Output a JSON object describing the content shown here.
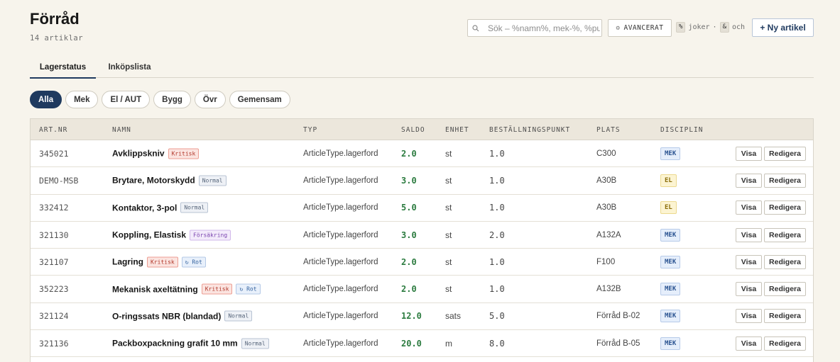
{
  "page": {
    "title": "Förråd",
    "count": "14 artiklar"
  },
  "search": {
    "placeholder": "Sök – %namn%, mek-%, %pump",
    "icon": "search-icon"
  },
  "advanced": {
    "label": "AVANCERAT",
    "icon": "gear-icon"
  },
  "hints": {
    "wildcard_key": "%",
    "wildcard_text": "joker",
    "sep": "·",
    "and_key": "&",
    "and_text": "och"
  },
  "new_button": {
    "label": "+ Ny artikel"
  },
  "tabs": [
    {
      "label": "Lagerstatus",
      "active": true
    },
    {
      "label": "Inköpslista",
      "active": false
    }
  ],
  "filters": [
    {
      "label": "Alla",
      "active": true
    },
    {
      "label": "Mek",
      "active": false
    },
    {
      "label": "El / AUT",
      "active": false
    },
    {
      "label": "Bygg",
      "active": false
    },
    {
      "label": "Övr",
      "active": false
    },
    {
      "label": "Gemensam",
      "active": false
    }
  ],
  "columns": {
    "artnr": "ART.NR",
    "namn": "NAMN",
    "typ": "TYP",
    "saldo": "SALDO",
    "enhet": "ENHET",
    "best": "BESTÄLLNINGSPUNKT",
    "plats": "PLATS",
    "disciplin": "DISCIPLIN"
  },
  "actions": {
    "view": "Visa",
    "edit": "Redigera"
  },
  "rows": [
    {
      "artnr": "345021",
      "namn": "Avklippskniv",
      "tags": [
        {
          "label": "Kritisk",
          "kind": "kritisk"
        }
      ],
      "typ": "ArticleType.lagerford",
      "saldo": "2.0",
      "enhet": "st",
      "best": "1.0",
      "plats": "C300",
      "disciplin": "MEK",
      "disc_kind": "mek"
    },
    {
      "artnr": "DEMO-MSB",
      "namn": "Brytare, Motorskydd",
      "tags": [
        {
          "label": "Normal",
          "kind": "normal"
        }
      ],
      "typ": "ArticleType.lagerford",
      "saldo": "3.0",
      "enhet": "st",
      "best": "1.0",
      "plats": "A30B",
      "disciplin": "EL",
      "disc_kind": "el"
    },
    {
      "artnr": "332412",
      "namn": "Kontaktor, 3-pol",
      "tags": [
        {
          "label": "Normal",
          "kind": "normal"
        }
      ],
      "typ": "ArticleType.lagerford",
      "saldo": "5.0",
      "enhet": "st",
      "best": "1.0",
      "plats": "A30B",
      "disciplin": "EL",
      "disc_kind": "el"
    },
    {
      "artnr": "321130",
      "namn": "Koppling, Elastisk",
      "tags": [
        {
          "label": "Försäkring",
          "kind": "forsakring"
        }
      ],
      "typ": "ArticleType.lagerford",
      "saldo": "3.0",
      "enhet": "st",
      "best": "2.0",
      "plats": "A132A",
      "disciplin": "MEK",
      "disc_kind": "mek"
    },
    {
      "artnr": "321107",
      "namn": "Lagring",
      "tags": [
        {
          "label": "Kritisk",
          "kind": "kritisk"
        },
        {
          "label": "↻ Rot",
          "kind": "rot"
        }
      ],
      "typ": "ArticleType.lagerford",
      "saldo": "2.0",
      "enhet": "st",
      "best": "1.0",
      "plats": "F100",
      "disciplin": "MEK",
      "disc_kind": "mek"
    },
    {
      "artnr": "352223",
      "namn": "Mekanisk axeltätning",
      "tags": [
        {
          "label": "Kritisk",
          "kind": "kritisk"
        },
        {
          "label": "↻ Rot",
          "kind": "rot"
        }
      ],
      "typ": "ArticleType.lagerford",
      "saldo": "2.0",
      "enhet": "st",
      "best": "1.0",
      "plats": "A132B",
      "disciplin": "MEK",
      "disc_kind": "mek"
    },
    {
      "artnr": "321124",
      "namn": "O-ringssats NBR (blandad)",
      "tags": [
        {
          "label": "Normal",
          "kind": "normal"
        }
      ],
      "typ": "ArticleType.lagerford",
      "saldo": "12.0",
      "enhet": "sats",
      "best": "5.0",
      "plats": "Förråd B-02",
      "disciplin": "MEK",
      "disc_kind": "mek"
    },
    {
      "artnr": "321136",
      "namn": "Packboxpackning grafit 10 mm",
      "tags": [
        {
          "label": "Normal",
          "kind": "normal"
        }
      ],
      "typ": "ArticleType.lagerford",
      "saldo": "20.0",
      "enhet": "m",
      "best": "8.0",
      "plats": "Förråd B-05",
      "disciplin": "MEK",
      "disc_kind": "mek"
    }
  ]
}
